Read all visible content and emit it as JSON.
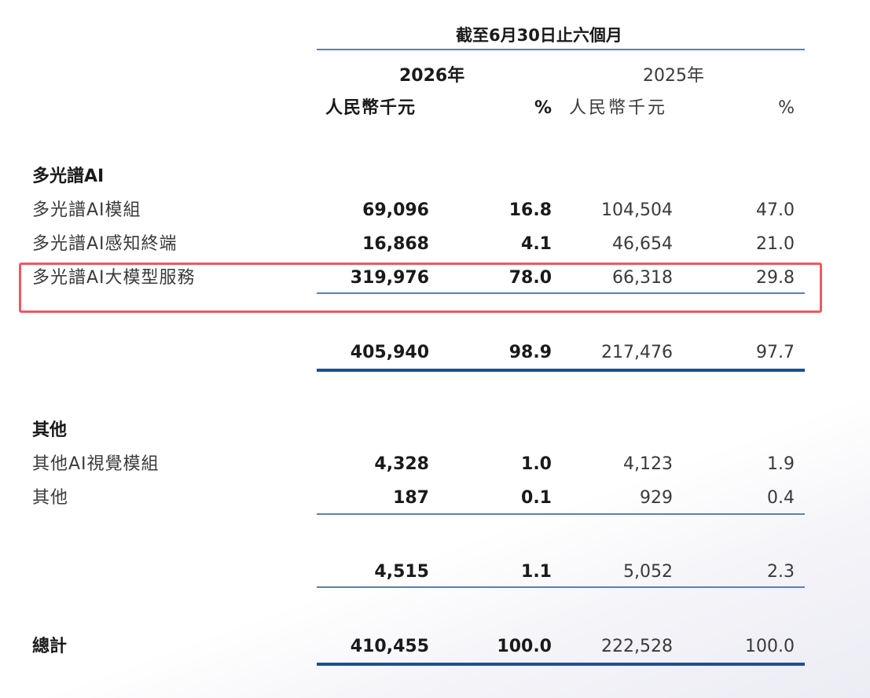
{
  "period_header": "截至6月30日止六個月",
  "years": {
    "current": "2026年",
    "prior": "2025年"
  },
  "units": {
    "rmb": "人民幣千元",
    "pct": "%"
  },
  "sections": {
    "multispectral": {
      "title": "多光譜AI",
      "rows": [
        {
          "label": "多光譜AI模組",
          "cur": "69,096",
          "cur_pct": "16.8",
          "prev": "104,504",
          "prev_pct": "47.0"
        },
        {
          "label": "多光譜AI感知終端",
          "cur": "16,868",
          "cur_pct": "4.1",
          "prev": "46,654",
          "prev_pct": "21.0"
        },
        {
          "label": "多光譜AI大模型服務",
          "cur": "319,976",
          "cur_pct": "78.0",
          "prev": "66,318",
          "prev_pct": "29.8"
        }
      ],
      "subtotal": {
        "cur": "405,940",
        "cur_pct": "98.9",
        "prev": "217,476",
        "prev_pct": "97.7"
      }
    },
    "others": {
      "title": "其他",
      "rows": [
        {
          "label": "其他AI視覺模組",
          "cur": "4,328",
          "cur_pct": "1.0",
          "prev": "4,123",
          "prev_pct": "1.9"
        },
        {
          "label": "其他",
          "cur": "187",
          "cur_pct": "0.1",
          "prev": "929",
          "prev_pct": "0.4"
        }
      ],
      "subtotal": {
        "cur": "4,515",
        "cur_pct": "1.1",
        "prev": "5,052",
        "prev_pct": "2.3"
      }
    }
  },
  "total": {
    "label": "總計",
    "cur": "410,455",
    "cur_pct": "100.0",
    "prev": "222,528",
    "prev_pct": "100.0"
  },
  "highlight_color": "#ec5a5f",
  "rule_color": "#1f4e96"
}
